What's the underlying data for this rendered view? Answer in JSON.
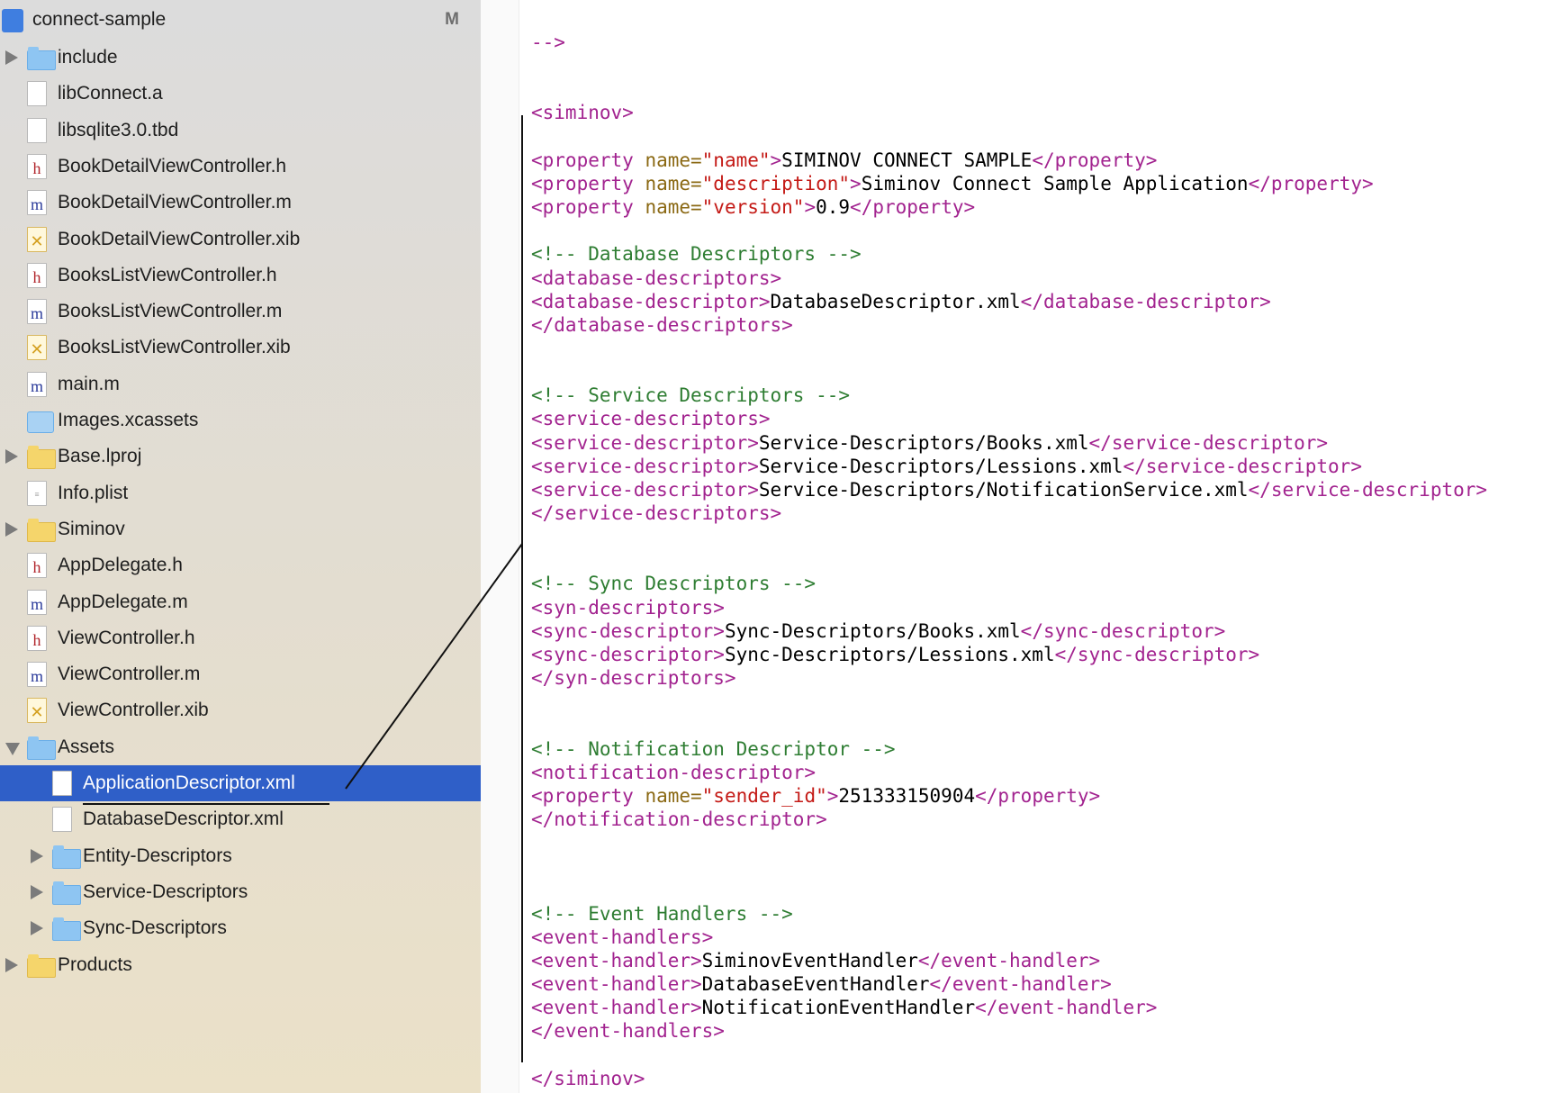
{
  "navigator": {
    "project": {
      "name": "connect-sample",
      "badge": "M"
    },
    "items": [
      {
        "label": "include",
        "kind": "folder-blue",
        "disclosure": "closed",
        "indent": 0
      },
      {
        "label": "libConnect.a",
        "kind": "file",
        "indent": 0
      },
      {
        "label": "libsqlite3.0.tbd",
        "kind": "file",
        "indent": 0
      },
      {
        "label": "BookDetailViewController.h",
        "kind": "h",
        "glyph": "h",
        "indent": 0
      },
      {
        "label": "BookDetailViewController.m",
        "kind": "m",
        "glyph": "m",
        "indent": 0
      },
      {
        "label": "BookDetailViewController.xib",
        "kind": "xib",
        "glyph": "✕",
        "indent": 0
      },
      {
        "label": "BooksListViewController.h",
        "kind": "h",
        "glyph": "h",
        "indent": 0
      },
      {
        "label": "BooksListViewController.m",
        "kind": "m",
        "glyph": "m",
        "indent": 0
      },
      {
        "label": "BooksListViewController.xib",
        "kind": "xib",
        "glyph": "✕",
        "indent": 0
      },
      {
        "label": "main.m",
        "kind": "m",
        "glyph": "m",
        "indent": 0
      },
      {
        "label": "Images.xcassets",
        "kind": "assets",
        "indent": 0
      },
      {
        "label": "Base.lproj",
        "kind": "folder-yellow",
        "disclosure": "closed",
        "indent": 0
      },
      {
        "label": "Info.plist",
        "kind": "plist",
        "glyph": "≡",
        "indent": 0
      },
      {
        "label": "Siminov",
        "kind": "folder-yellow",
        "disclosure": "closed",
        "indent": 0
      },
      {
        "label": "AppDelegate.h",
        "kind": "h",
        "glyph": "h",
        "indent": 0
      },
      {
        "label": "AppDelegate.m",
        "kind": "m",
        "glyph": "m",
        "indent": 0
      },
      {
        "label": "ViewController.h",
        "kind": "h",
        "glyph": "h",
        "indent": 0
      },
      {
        "label": "ViewController.m",
        "kind": "m",
        "glyph": "m",
        "indent": 0
      },
      {
        "label": "ViewController.xib",
        "kind": "xib",
        "glyph": "✕",
        "indent": 0
      },
      {
        "label": "Assets",
        "kind": "folder-blue",
        "disclosure": "open",
        "indent": 0
      },
      {
        "label": "ApplicationDescriptor.xml",
        "kind": "file",
        "indent": 1,
        "selected": true
      },
      {
        "label": "DatabaseDescriptor.xml",
        "kind": "file",
        "indent": 1
      },
      {
        "label": "Entity-Descriptors",
        "kind": "folder-blue",
        "disclosure": "closed",
        "indent": 1
      },
      {
        "label": "Service-Descriptors",
        "kind": "folder-blue",
        "disclosure": "closed",
        "indent": 1
      },
      {
        "label": "Sync-Descriptors",
        "kind": "folder-blue",
        "disclosure": "closed",
        "indent": 1
      },
      {
        "label": "Products",
        "kind": "folder-yellow",
        "disclosure": "closed",
        "indent": 0
      }
    ]
  },
  "editor": {
    "lines": [
      [
        {
          "c": "tag",
          "t": "-->"
        }
      ],
      [],
      [],
      [
        {
          "c": "tag",
          "t": "<siminov>"
        }
      ],
      [],
      [
        {
          "c": "tag",
          "t": "<property "
        },
        {
          "c": "attr",
          "t": "name="
        },
        {
          "c": "val",
          "t": "\"name\""
        },
        {
          "c": "tag",
          "t": ">"
        },
        {
          "c": "txt",
          "t": "SIMINOV CONNECT SAMPLE"
        },
        {
          "c": "tag",
          "t": "</property>"
        }
      ],
      [
        {
          "c": "tag",
          "t": "<property "
        },
        {
          "c": "attr",
          "t": "name="
        },
        {
          "c": "val",
          "t": "\"description\""
        },
        {
          "c": "tag",
          "t": ">"
        },
        {
          "c": "txt",
          "t": "Siminov Connect Sample Application"
        },
        {
          "c": "tag",
          "t": "</property>"
        }
      ],
      [
        {
          "c": "tag",
          "t": "<property "
        },
        {
          "c": "attr",
          "t": "name="
        },
        {
          "c": "val",
          "t": "\"version\""
        },
        {
          "c": "tag",
          "t": ">"
        },
        {
          "c": "txt",
          "t": "0.9"
        },
        {
          "c": "tag",
          "t": "</property>"
        }
      ],
      [],
      [
        {
          "c": "cmt",
          "t": "<!-- Database Descriptors -->"
        }
      ],
      [
        {
          "c": "tag",
          "t": "<database-descriptors>"
        }
      ],
      [
        {
          "c": "tag",
          "t": "<database-descriptor>"
        },
        {
          "c": "txt",
          "t": "DatabaseDescriptor.xml"
        },
        {
          "c": "tag",
          "t": "</database-descriptor>"
        }
      ],
      [
        {
          "c": "tag",
          "t": "</database-descriptors>"
        }
      ],
      [],
      [],
      [
        {
          "c": "cmt",
          "t": "<!-- Service Descriptors -->"
        }
      ],
      [
        {
          "c": "tag",
          "t": "<service-descriptors>"
        }
      ],
      [
        {
          "c": "tag",
          "t": "<service-descriptor>"
        },
        {
          "c": "txt",
          "t": "Service-Descriptors/Books.xml"
        },
        {
          "c": "tag",
          "t": "</service-descriptor>"
        }
      ],
      [
        {
          "c": "tag",
          "t": "<service-descriptor>"
        },
        {
          "c": "txt",
          "t": "Service-Descriptors/Lessions.xml"
        },
        {
          "c": "tag",
          "t": "</service-descriptor>"
        }
      ],
      [
        {
          "c": "tag",
          "t": "<service-descriptor>"
        },
        {
          "c": "txt",
          "t": "Service-Descriptors/NotificationService.xml"
        },
        {
          "c": "tag",
          "t": "</service-descriptor>"
        }
      ],
      [
        {
          "c": "tag",
          "t": "</service-descriptors>"
        }
      ],
      [],
      [],
      [
        {
          "c": "cmt",
          "t": "<!-- Sync Descriptors -->"
        }
      ],
      [
        {
          "c": "tag",
          "t": "<syn-descriptors>"
        }
      ],
      [
        {
          "c": "tag",
          "t": "<sync-descriptor>"
        },
        {
          "c": "txt",
          "t": "Sync-Descriptors/Books.xml"
        },
        {
          "c": "tag",
          "t": "</sync-descriptor>"
        }
      ],
      [
        {
          "c": "tag",
          "t": "<sync-descriptor>"
        },
        {
          "c": "txt",
          "t": "Sync-Descriptors/Lessions.xml"
        },
        {
          "c": "tag",
          "t": "</sync-descriptor>"
        }
      ],
      [
        {
          "c": "tag",
          "t": "</syn-descriptors>"
        }
      ],
      [],
      [],
      [
        {
          "c": "cmt",
          "t": "<!-- Notification Descriptor -->"
        }
      ],
      [
        {
          "c": "tag",
          "t": "<notification-descriptor>"
        }
      ],
      [
        {
          "c": "tag",
          "t": "<property "
        },
        {
          "c": "attr",
          "t": "name="
        },
        {
          "c": "val",
          "t": "\"sender_id\""
        },
        {
          "c": "tag",
          "t": ">"
        },
        {
          "c": "txt",
          "t": "251333150904"
        },
        {
          "c": "tag",
          "t": "</property>"
        }
      ],
      [
        {
          "c": "tag",
          "t": "</notification-descriptor>"
        }
      ],
      [],
      [],
      [],
      [
        {
          "c": "cmt",
          "t": "<!-- Event Handlers -->"
        }
      ],
      [
        {
          "c": "tag",
          "t": "<event-handlers>"
        }
      ],
      [
        {
          "c": "tag",
          "t": "<event-handler>"
        },
        {
          "c": "txt",
          "t": "SiminovEventHandler"
        },
        {
          "c": "tag",
          "t": "</event-handler>"
        }
      ],
      [
        {
          "c": "tag",
          "t": "<event-handler>"
        },
        {
          "c": "txt",
          "t": "DatabaseEventHandler"
        },
        {
          "c": "tag",
          "t": "</event-handler>"
        }
      ],
      [
        {
          "c": "tag",
          "t": "<event-handler>"
        },
        {
          "c": "txt",
          "t": "NotificationEventHandler"
        },
        {
          "c": "tag",
          "t": "</event-handler>"
        }
      ],
      [
        {
          "c": "tag",
          "t": "</event-handlers>"
        }
      ],
      [],
      [
        {
          "c": "tag",
          "t": "</siminov>"
        }
      ]
    ]
  }
}
